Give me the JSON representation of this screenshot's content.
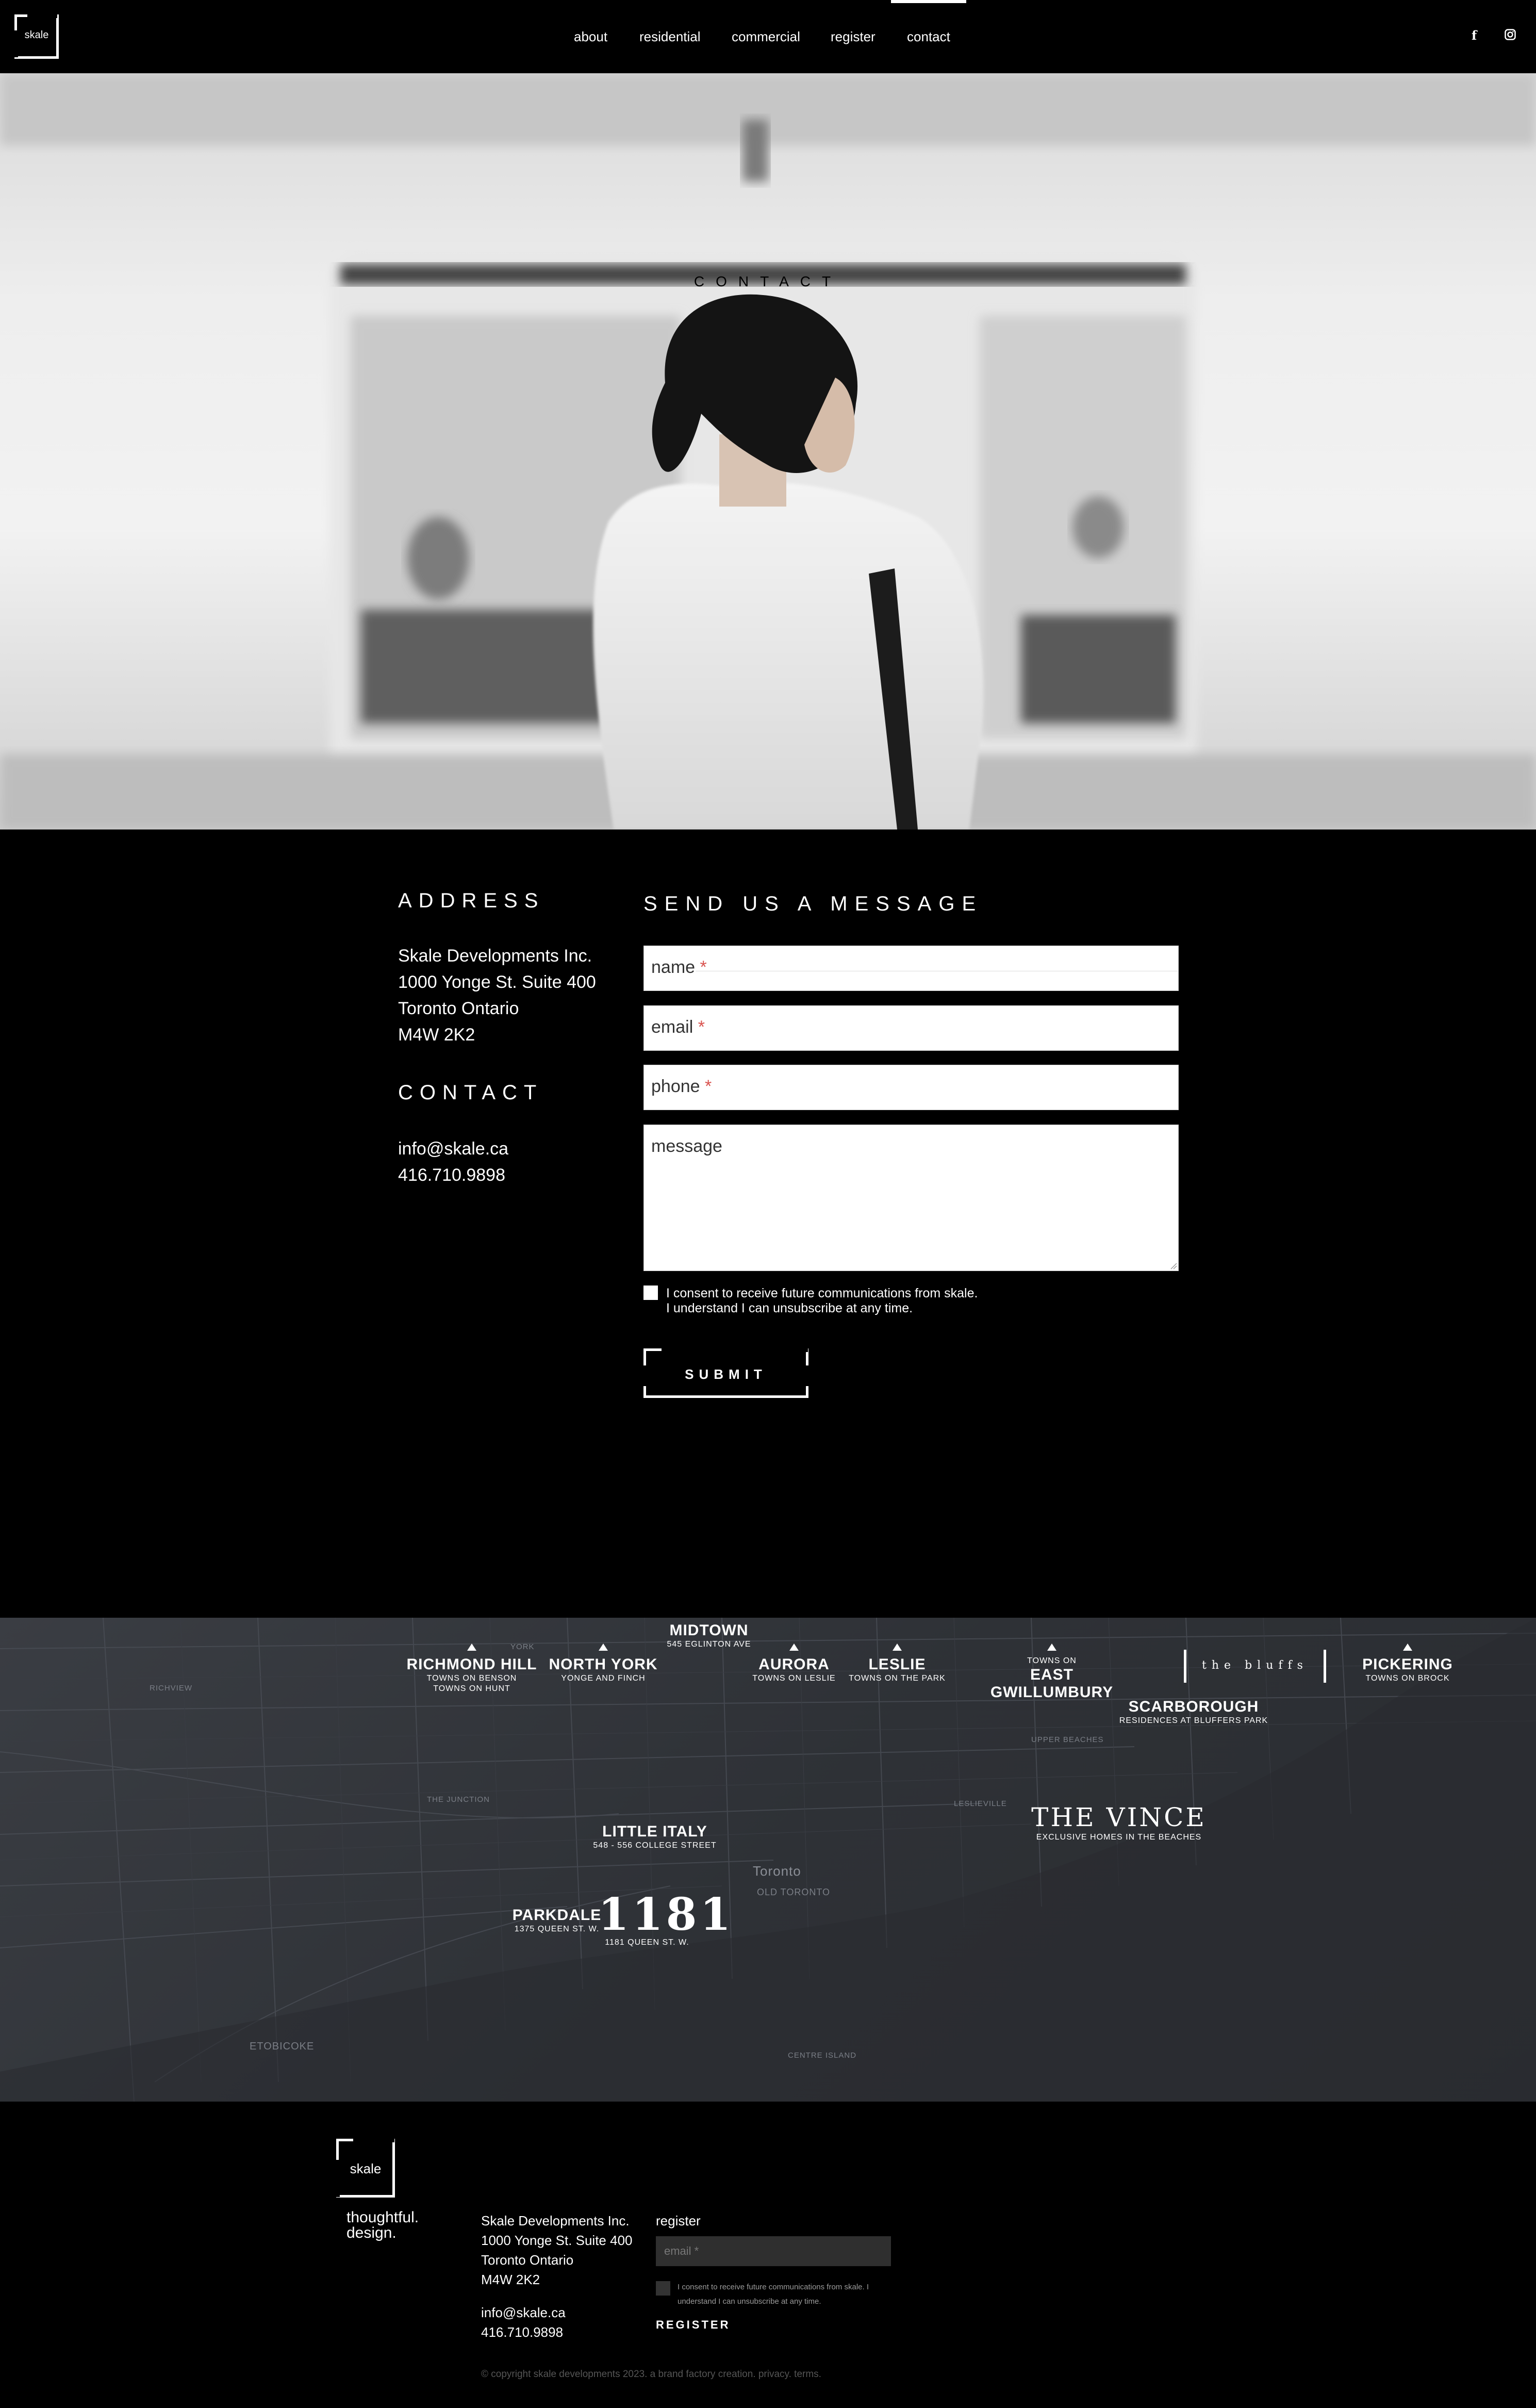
{
  "header": {
    "logo_text": "skale",
    "nav": [
      "about",
      "residential",
      "commercial",
      "register",
      "contact"
    ],
    "active": "contact",
    "social": [
      "f",
      "ig"
    ]
  },
  "hero": {
    "title": "CONTACT"
  },
  "address": {
    "heading": "ADDRESS",
    "lines": [
      "Skale Developments Inc.",
      "1000 Yonge St. Suite 400",
      "Toronto Ontario",
      "M4W 2K2"
    ]
  },
  "contact": {
    "heading": "CONTACT",
    "email": "info@skale.ca",
    "phone": "416.710.9898"
  },
  "form": {
    "heading": "SEND US A MESSAGE",
    "name_label": "name",
    "email_label": "email",
    "phone_label": "phone",
    "message_label": "message",
    "required_mark": "*",
    "consent_line1": "I consent to receive future communications from skale.",
    "consent_line2": "I understand I can unsubscribe at any time.",
    "submit": "SUBMIT"
  },
  "map": {
    "locations": [
      {
        "name": "RICHMOND HILL",
        "sub": [
          "TOWNS ON BENSON",
          "TOWNS ON HUNT"
        ]
      },
      {
        "name": "NORTH YORK",
        "sub": [
          "YONGE AND FINCH"
        ]
      },
      {
        "name": "MIDTOWN",
        "sub": [
          "545 EGLINTON AVE"
        ]
      },
      {
        "name": "AURORA",
        "sub": [
          "TOWNS ON LESLIE"
        ]
      },
      {
        "name": "LESLIE",
        "sub": [
          "TOWNS ON THE PARK"
        ]
      },
      {
        "name": "EAST GWILLUMBURY",
        "sub": [
          "TOWNS ON"
        ]
      },
      {
        "name": "the bluffs",
        "sub": []
      },
      {
        "name": "PICKERING",
        "sub": [
          "TOWNS ON BROCK"
        ]
      },
      {
        "name": "SCARBOROUGH",
        "sub": [
          "RESIDENCES AT BLUFFERS PARK"
        ]
      },
      {
        "name": "THE VINCE",
        "sub": [
          "EXCLUSIVE HOMES IN THE BEACHES"
        ]
      },
      {
        "name": "LITTLE ITALY",
        "sub": [
          "548 - 556 COLLEGE STREET"
        ]
      },
      {
        "name": "PARKDALE",
        "sub": [
          "1375 QUEEN ST. W."
        ]
      },
      {
        "name": "1181",
        "sub": [
          "1181 QUEEN ST. W."
        ]
      }
    ],
    "streets": [
      "Toronto",
      "OLD TORONTO",
      "ETOBICOKE",
      "RICHVIEW",
      "THE JUNCTION",
      "CENTRE ISLAND",
      "YORK",
      "LESLIEVILLE",
      "UPPER BEACHES"
    ]
  },
  "footer": {
    "logo_text": "skale",
    "tagline": [
      "thoughtful.",
      "design."
    ],
    "address": [
      "Skale Developments Inc.",
      "1000 Yonge St. Suite 400",
      "Toronto Ontario",
      "M4W 2K2"
    ],
    "email": "info@skale.ca",
    "phone": "416.710.9898",
    "register_label": "register",
    "email_placeholder": "email *",
    "consent": [
      "I consent to receive future communications from skale. I",
      "understand I can unsubscribe at any time."
    ],
    "register_button": "REGISTER",
    "copyright": "© copyright skale developments 2023. a brand factory creation. privacy. terms."
  }
}
